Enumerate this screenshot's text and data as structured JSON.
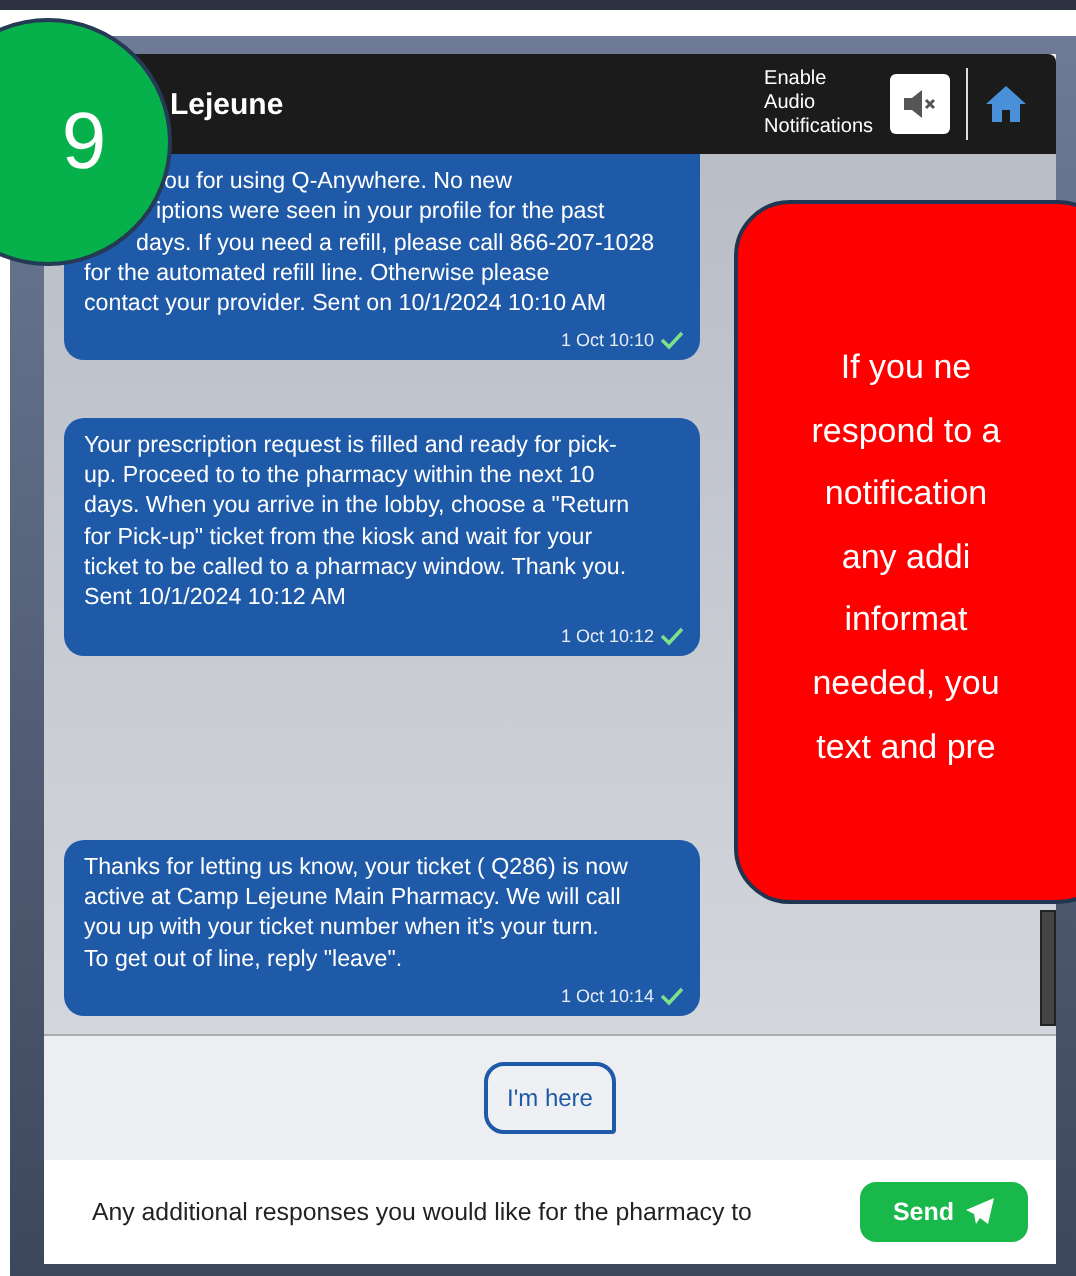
{
  "badge": {
    "number": "9"
  },
  "header": {
    "title": "Lejeune",
    "audio_label": "Enable\nAudio\nNotifications",
    "audio_muted": true
  },
  "messages": [
    {
      "lines": [
        "ou for using Q-Anywhere. No new",
        "iptions were seen in your profile for the past",
        "days. If you need a refill, please call 866-207-1028",
        "for the automated refill line. Otherwise please",
        "contact your provider. Sent on 10/1/2024 10:10 AM"
      ],
      "time": "1 Oct 10:10",
      "delivered": true
    },
    {
      "lines": [
        "Your prescription request is filled and ready for pick-",
        "up. Proceed to to the pharmacy within the next 10",
        "days. When you arrive in the lobby, choose a \"Return",
        "for Pick-up\" ticket from the kiosk and wait for your",
        "ticket to be called to a pharmacy window. Thank you.",
        "Sent 10/1/2024 10:12 AM"
      ],
      "time": "1 Oct 10:12",
      "delivered": true
    },
    {
      "lines": [
        "Thanks for letting us know, your ticket ( Q286) is now",
        "active at Camp Lejeune Main Pharmacy. We will call",
        "you up with your ticket number when it's your turn.",
        "To get out of line, reply \"leave\"."
      ],
      "time": "1 Oct 10:14",
      "delivered": true
    }
  ],
  "quick_replies": [
    {
      "label": "I'm here"
    }
  ],
  "composer": {
    "placeholder": "Any additional responses you would like for the pharmacy to",
    "send_label": "Send"
  },
  "callout": {
    "lines": [
      "If you ne",
      "respond to a",
      "notification",
      "any addi",
      "informat",
      "needed, you",
      "text and pre"
    ]
  }
}
